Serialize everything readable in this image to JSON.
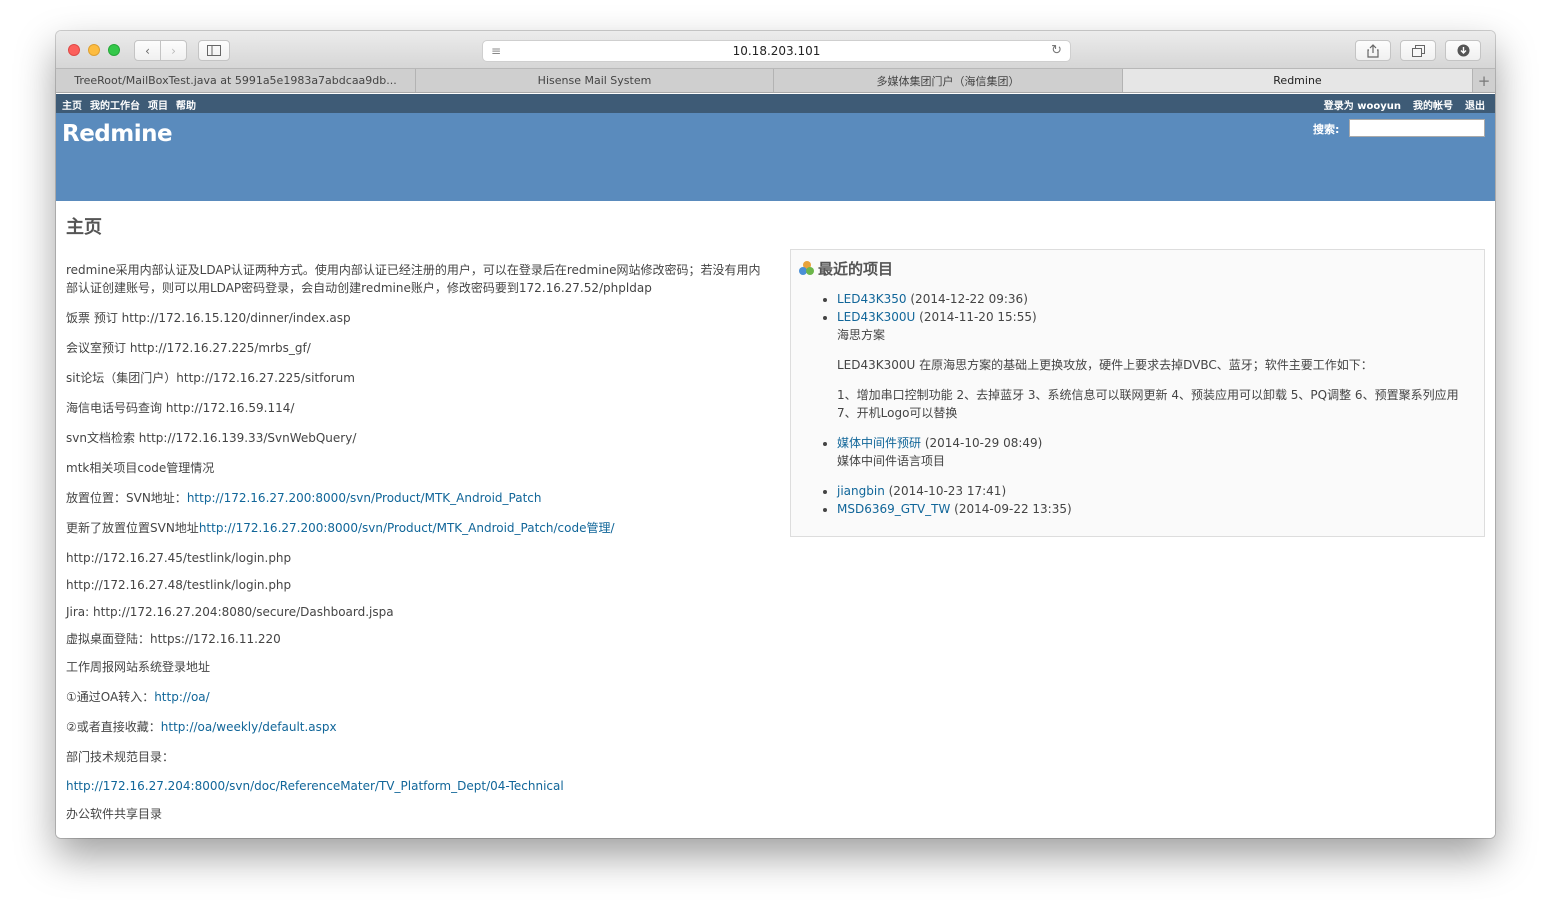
{
  "browser": {
    "url": "10.18.203.101",
    "tabs": [
      {
        "label": "TreeRoot/MailBoxTest.java at 5991a5e1983a7abdcaa9db..."
      },
      {
        "label": "Hisense Mail System"
      },
      {
        "label": "多媒体集团门户（海信集团）"
      },
      {
        "label": "Redmine"
      }
    ]
  },
  "top_menu": {
    "left": [
      "主页",
      "我的工作台",
      "项目",
      "帮助"
    ],
    "logged_in_prefix": "登录为",
    "user": "wooyun",
    "my_account": "我的帐号",
    "logout": "退出"
  },
  "header": {
    "title": "Redmine",
    "search_label": "搜索:"
  },
  "page": {
    "title": "主页",
    "paragraphs": [
      {
        "text": "redmine采用内部认证及LDAP认证两种方式。使用内部认证已经注册的用户，可以在登录后在redmine网站修改密码；若没有用内部认证创建账号，则可以用LDAP密码登录，会自动创建redmine账户，修改密码要到172.16.27.52/phpldap",
        "prefix": "",
        "link": ""
      },
      {
        "text": "饭票 预订 http://172.16.15.120/dinner/index.asp",
        "prefix": "",
        "link": ""
      },
      {
        "text": "会议室预订 http://172.16.27.225/mrbs_gf/",
        "prefix": "",
        "link": ""
      },
      {
        "text": "sit论坛（集团门户）http://172.16.27.225/sitforum",
        "prefix": "",
        "link": ""
      },
      {
        "text": "海信电话号码查询 http://172.16.59.114/",
        "prefix": "",
        "link": ""
      },
      {
        "text": "svn文档检索 http://172.16.139.33/SvnWebQuery/",
        "prefix": "",
        "link": ""
      },
      {
        "text": "mtk相关项目code管理情况",
        "prefix": "",
        "link": ""
      },
      {
        "text": "",
        "prefix": " 放置位置：SVN地址：",
        "link": "http://172.16.27.200:8000/svn/Product/MTK_Android_Patch"
      },
      {
        "text": "",
        "prefix": " 更新了放置位置SVN地址",
        "link": "http://172.16.27.200:8000/svn/Product/MTK_Android_Patch/code管理/"
      },
      {
        "text": "http://172.16.27.45/testlink/login.php",
        "prefix": "",
        "link": ""
      },
      {
        "text": "http://172.16.27.48/testlink/login.php",
        "prefix": "",
        "link": ""
      },
      {
        "text": "Jira:  http://172.16.27.204:8080/secure/Dashboard.jspa",
        "prefix": "",
        "link": ""
      },
      {
        "text": "虚拟桌面登陆：https://172.16.11.220",
        "prefix": "",
        "link": ""
      },
      {
        "text": "工作周报网站系统登录地址",
        "prefix": "",
        "link": ""
      },
      {
        "text": "",
        "prefix": "①通过OA转入：",
        "link": "http://oa/"
      },
      {
        "text": "",
        "prefix": "②或者直接收藏：",
        "link": "http://oa/weekly/default.aspx"
      },
      {
        "text": "部门技术规范目录：",
        "prefix": "",
        "link": ""
      },
      {
        "text": "",
        "prefix": "",
        "link": "http://172.16.27.204:8000/svn/doc/ReferenceMater/TV_Platform_Dept/04-Technical"
      },
      {
        "text": "办公软件共享目录",
        "prefix": "",
        "link": ""
      }
    ]
  },
  "recent_projects": {
    "title": "最近的项目",
    "items": [
      {
        "name": "LED43K350",
        "date": "(2014-12-22 09:36)",
        "desc": []
      },
      {
        "name": "LED43K300U",
        "date": "(2014-11-20 15:55)",
        "desc": [
          "海思方案",
          "LED43K300U 在原海思方案的基础上更换攻放，硬件上要求去掉DVBC、蓝牙；软件主要工作如下：",
          "1、增加串口控制功能 2、去掉蓝牙 3、系统信息可以联网更新 4、预装应用可以卸载  5、PQ调整  6、预置聚系列应用 7、开机Logo可以替换"
        ]
      },
      {
        "name": "媒体中间件预研",
        "date": "(2014-10-29 08:49)",
        "desc": [
          "媒体中间件语言项目"
        ]
      },
      {
        "name": "jiangbin",
        "date": "(2014-10-23 17:41)",
        "desc": []
      },
      {
        "name": "MSD6369_GTV_TW",
        "date": "(2014-09-22 13:35)",
        "desc": []
      }
    ]
  },
  "colors": {
    "top_menu_bg": "#3e5b76",
    "header_bg": "#5a8bbd",
    "link": "#116699"
  },
  "icons": [
    "reader-icon",
    "reload-icon",
    "back-icon",
    "forward-icon",
    "sidebar-icon",
    "share-icon",
    "tabs-overview-icon",
    "download-icon",
    "projects-icon"
  ]
}
